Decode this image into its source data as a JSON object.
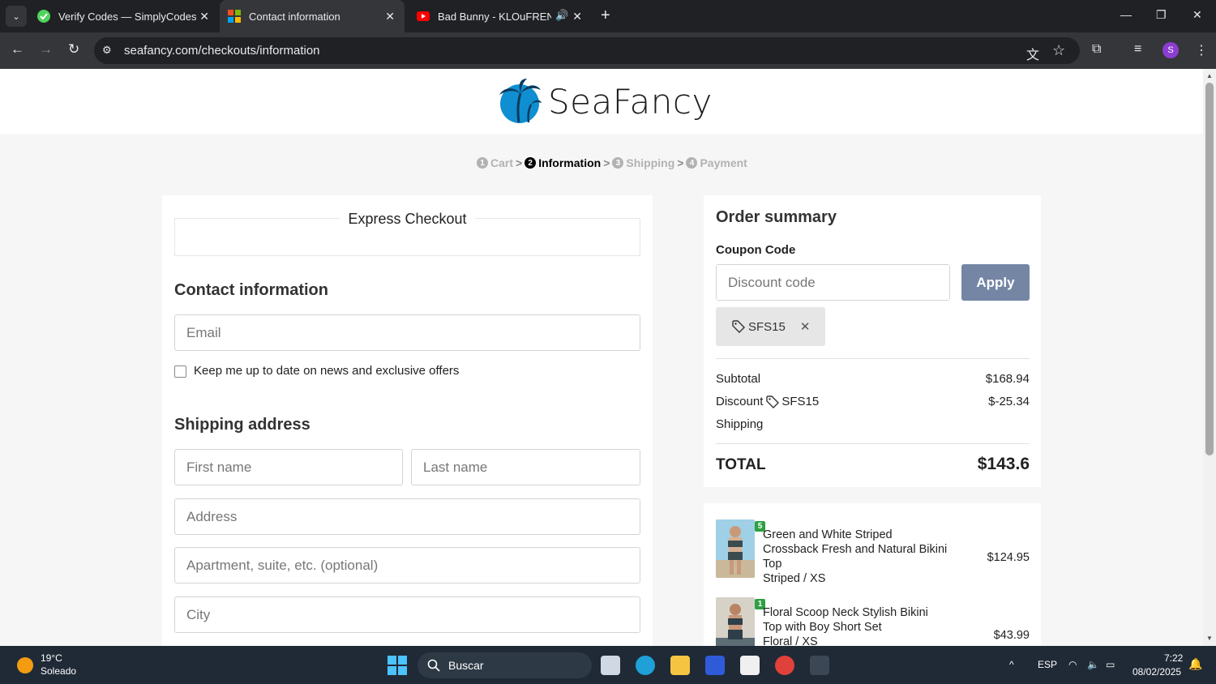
{
  "browser": {
    "tabs": [
      {
        "title": "Verify Codes — SimplyCodes",
        "icon": "simplycodes-icon"
      },
      {
        "title": "Contact information",
        "icon": "site-icon",
        "active": true
      },
      {
        "title": "Bad Bunny - KLOuFRENS (V",
        "icon": "youtube-icon"
      }
    ],
    "url": "seafancy.com/checkouts/information"
  },
  "site": {
    "brand": "SeaFancy",
    "steps": [
      {
        "num": "1",
        "label": "Cart"
      },
      {
        "num": "2",
        "label": "Information"
      },
      {
        "num": "3",
        "label": "Shipping"
      },
      {
        "num": "4",
        "label": "Payment"
      }
    ],
    "step_separator": ">"
  },
  "checkout": {
    "express_title": "Express Checkout",
    "contact_title": "Contact information",
    "email_placeholder": "Email",
    "newsletter_label": "Keep me up to date on news and exclusive offers",
    "shipping_title": "Shipping address",
    "first_name_placeholder": "First name",
    "last_name_placeholder": "Last name",
    "address_placeholder": "Address",
    "apartment_placeholder": "Apartment, suite, etc. (optional)",
    "city_placeholder": "City"
  },
  "summary": {
    "title": "Order summary",
    "coupon_label": "Coupon Code",
    "discount_placeholder": "Discount code",
    "apply_label": "Apply",
    "applied_code": "SFS15",
    "subtotal_label": "Subtotal",
    "subtotal_value": "$168.94",
    "discount_label": "Discount",
    "discount_code": "SFS15",
    "discount_value": "$-25.34",
    "shipping_label": "Shipping",
    "total_label": "TOTAL",
    "total_value": "$143.6",
    "accent_color": "#7486a4"
  },
  "items": [
    {
      "qty": "5",
      "name": "Green and White Striped Crossback Fresh and Natural Bikini Top",
      "variant": "Striped / XS",
      "price": "$124.95"
    },
    {
      "qty": "1",
      "name": "Floral Scoop Neck Stylish Bikini Top with Boy Short Set",
      "variant": "Floral / XS",
      "price": "$43.99"
    }
  ],
  "taskbar": {
    "temperature": "19°C",
    "weather": "Soleado",
    "search_label": "Buscar",
    "language": "ESP",
    "time": "7:22",
    "date": "08/02/2025"
  }
}
